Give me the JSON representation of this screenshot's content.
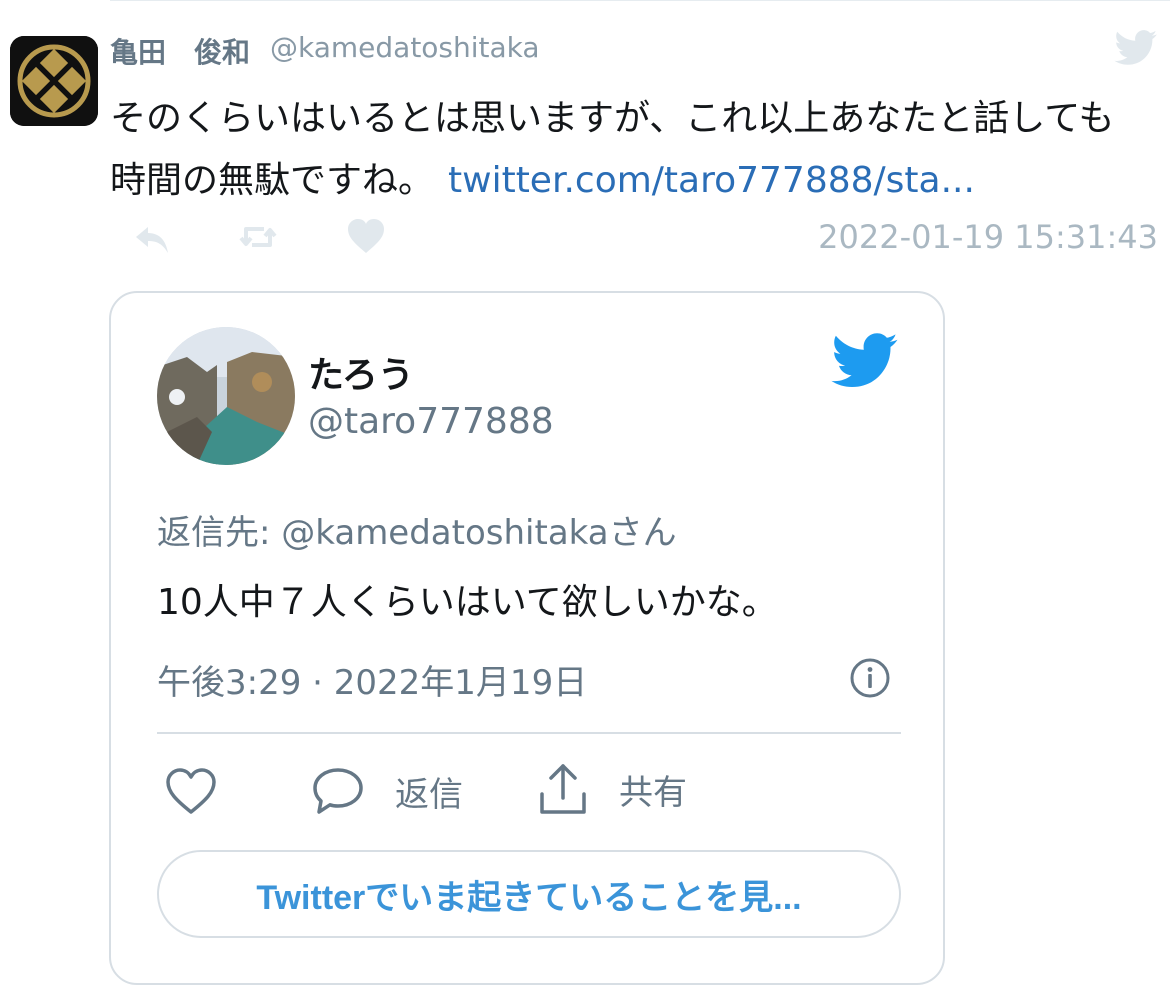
{
  "tweet": {
    "name": "亀田　俊和",
    "handle": "@kamedatoshitaka",
    "text": "そのくらいはいるとは思いますが、これ以上あなたと話しても時間の無駄ですね。",
    "link": "twitter.com/taro777888/sta...",
    "timestamp": "2022-01-19 15:31:43",
    "icons": {
      "platform": "twitter-bird-icon",
      "reply": "reply-arrow-icon",
      "retweet": "retweet-icon",
      "like": "heart-icon"
    }
  },
  "embed": {
    "name": "たろう",
    "handle": "@taro777888",
    "reply_to": "返信先: @kamedatoshitakaさん",
    "text": "10人中７人くらいはいて欲しいかな。",
    "time": "午後3:29 · 2022年1月19日",
    "reply_label": "返信",
    "share_label": "共有",
    "cta_label": "Twitterでいま起きていることを見...",
    "icons": {
      "platform": "twitter-bird-icon",
      "info": "info-icon",
      "like": "heart-outline-icon",
      "reply": "speech-bubble-icon",
      "share": "share-upload-icon"
    }
  },
  "colors": {
    "link": "#2a6db6",
    "twitter_blue": "#1d9bf0",
    "muted": "#657786",
    "border": "#d7dee4"
  }
}
